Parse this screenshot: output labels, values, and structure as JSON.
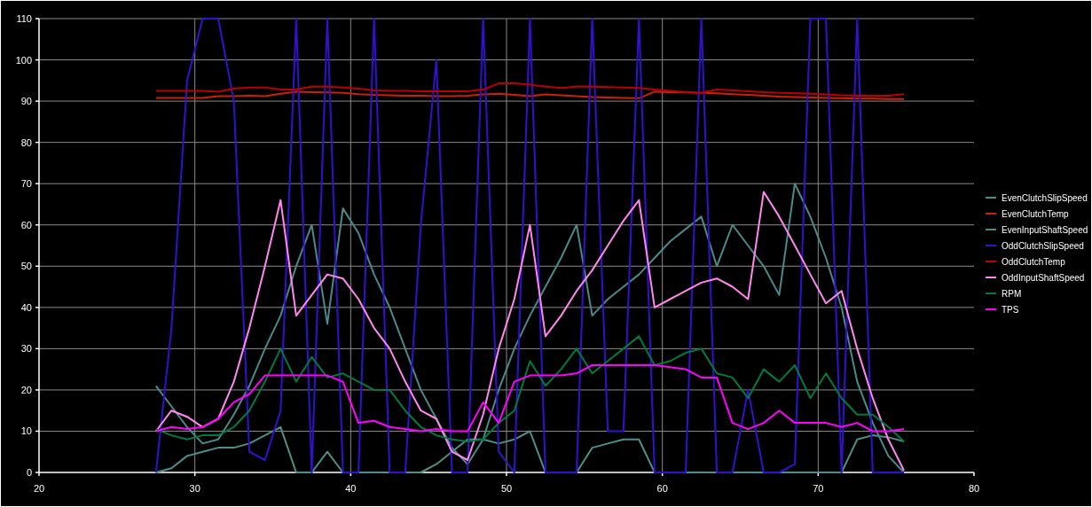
{
  "chart": {
    "chart_data": {
      "type": "line",
      "grid": true,
      "xlim": [
        20,
        80
      ],
      "ylim": [
        0,
        110
      ],
      "xticks": [
        20,
        30,
        40,
        50,
        60,
        70,
        80
      ],
      "yticks": [
        0,
        10,
        20,
        30,
        40,
        50,
        60,
        70,
        80,
        90,
        100,
        110
      ],
      "x": [
        27.5,
        28.5,
        29.5,
        30.5,
        31.5,
        32.5,
        33.5,
        34.5,
        35.5,
        36.5,
        37.5,
        38.5,
        39.5,
        40.5,
        41.5,
        42.5,
        43.5,
        44.5,
        45.5,
        46.5,
        47.5,
        48.5,
        49.5,
        50.5,
        51.5,
        52.5,
        53.5,
        54.5,
        55.5,
        56.5,
        57.5,
        58.5,
        59.5,
        60.5,
        61.5,
        62.5,
        63.5,
        64.5,
        65.5,
        66.5,
        67.5,
        68.5,
        69.5,
        70.5,
        71.5,
        72.5,
        73.5,
        74.5,
        75.5
      ],
      "series": [
        {
          "name": "EvenClutchSlipSpeed",
          "color": "#4f8f8a",
          "values": [
            0,
            1,
            4,
            5,
            6,
            6,
            7,
            9,
            11,
            0,
            0,
            5,
            0,
            0,
            0,
            0,
            0,
            0,
            2,
            5,
            8,
            8,
            7,
            8,
            10,
            0,
            0,
            0,
            6,
            7,
            8,
            8,
            0,
            0,
            0,
            0,
            0,
            0,
            0,
            0,
            0,
            0,
            0,
            0,
            0,
            8,
            9,
            8.5,
            7.5
          ]
        },
        {
          "name": "EvenClutchTemp",
          "color": "#cc2200",
          "values": [
            90.8,
            90.8,
            90.8,
            90.8,
            91.2,
            91.2,
            91.3,
            91.2,
            91.8,
            92.3,
            92.2,
            92.1,
            92,
            91.7,
            91.5,
            91.4,
            91.3,
            91.3,
            91.2,
            91.2,
            91.3,
            91.6,
            91.8,
            91.5,
            91.2,
            91.6,
            91.4,
            91.2,
            91,
            90.9,
            90.8,
            90.7,
            92.3,
            92.2,
            92.1,
            92,
            91.9,
            91.7,
            91.5,
            91.3,
            91.1,
            91,
            90.9,
            90.8,
            90.7,
            90.6,
            90.6,
            90.5,
            90.5
          ]
        },
        {
          "name": "EvenInputShaftSpeed",
          "color": "#4a8a8a",
          "values": [
            21,
            16,
            11,
            7,
            8,
            14,
            21,
            30,
            38,
            50,
            60,
            36,
            64,
            58,
            48,
            40,
            30,
            20,
            13,
            6,
            2,
            8,
            20,
            30,
            38,
            45,
            52,
            60,
            38,
            42,
            45,
            48,
            52,
            56,
            59,
            62,
            50,
            60,
            55,
            50,
            43,
            70,
            62,
            52,
            40,
            22,
            12,
            4,
            0
          ]
        },
        {
          "name": "OddClutchSlipSpeed",
          "color": "#3311cc",
          "values": [
            0,
            35,
            95,
            110,
            110,
            90,
            5,
            3,
            15,
            110,
            0,
            110,
            0,
            0,
            110,
            0,
            0,
            60,
            100,
            0,
            0,
            110,
            5,
            0,
            110,
            0,
            0,
            0,
            110,
            10,
            10,
            110,
            0,
            0,
            0,
            110,
            0,
            0,
            20,
            0,
            0,
            2,
            110,
            110,
            0,
            110,
            0,
            0,
            0
          ]
        },
        {
          "name": "OddClutchTemp",
          "color": "#bb0000",
          "values": [
            92.5,
            92.5,
            92.5,
            92.5,
            92.3,
            93,
            93.3,
            93.3,
            92.8,
            92.8,
            93.5,
            93.5,
            93.3,
            93,
            92.6,
            92.5,
            92.5,
            92.4,
            92.4,
            92.4,
            92.4,
            92.8,
            94.3,
            94.3,
            94,
            93.5,
            93.2,
            93.5,
            93.5,
            93.4,
            93.3,
            93.2,
            92.8,
            92.5,
            92.2,
            92,
            92.8,
            92.6,
            92.4,
            92.2,
            92,
            91.9,
            91.8,
            91.6,
            91.4,
            91.3,
            91.3,
            91.3,
            91.7
          ]
        },
        {
          "name": "OddInputShaftSpeed",
          "color": "#ff88ee",
          "values": [
            10,
            15,
            13.5,
            11,
            13,
            22,
            35,
            50,
            66,
            38,
            43,
            48,
            47,
            42,
            35,
            30,
            22,
            15,
            13,
            5,
            3,
            14,
            30,
            42,
            60,
            33,
            38,
            44,
            49,
            55,
            61,
            66,
            40,
            42,
            44,
            46,
            47,
            45,
            42,
            68,
            62,
            55,
            48,
            41,
            44,
            30,
            18,
            8,
            0.5
          ]
        },
        {
          "name": "RPM",
          "color": "#007a40",
          "values": [
            10.5,
            9,
            8,
            9,
            9,
            11,
            15,
            22,
            30,
            22,
            28,
            23,
            24,
            22,
            20,
            20,
            15,
            11,
            9,
            8,
            7.5,
            8,
            12,
            15,
            27,
            21,
            25,
            30,
            24,
            27,
            30,
            33,
            26,
            27,
            29,
            30,
            24,
            23,
            18,
            25,
            22,
            26,
            18,
            24,
            18,
            14,
            14,
            11,
            7.5
          ]
        },
        {
          "name": "TPS",
          "color": "#ff00ff",
          "values": [
            10,
            11,
            10.5,
            11,
            13,
            17,
            19,
            23.5,
            23.5,
            23.5,
            23.5,
            23.5,
            22,
            12,
            12.5,
            11,
            10.5,
            10,
            10.5,
            10,
            10,
            17,
            12,
            22,
            23.5,
            23.5,
            23.5,
            24,
            26,
            26,
            26,
            26,
            26,
            25.5,
            25,
            23,
            23,
            12,
            10.5,
            12,
            15,
            12,
            12,
            12,
            11,
            12,
            10,
            10,
            10.5
          ]
        }
      ]
    }
  }
}
